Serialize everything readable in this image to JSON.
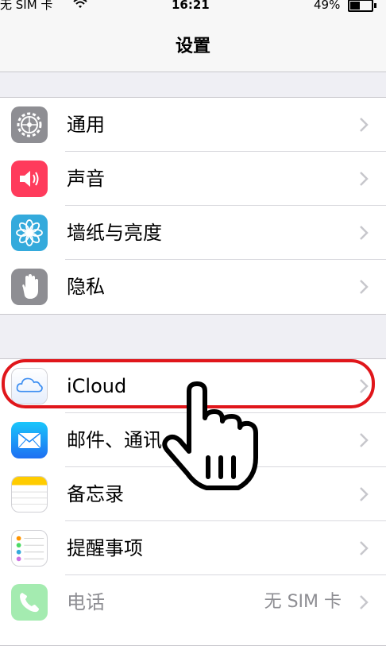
{
  "status_bar": {
    "carrier": "无 SIM 卡",
    "time": "16:21",
    "battery_percent": "49%",
    "battery_level": 0.49
  },
  "nav": {
    "title": "设置"
  },
  "group1": [
    {
      "label": "通用",
      "icon": "gear-icon",
      "color": "#8e8e93"
    },
    {
      "label": "声音",
      "icon": "speaker-icon",
      "color": "#ff3b5c"
    },
    {
      "label": "墙纸与亮度",
      "icon": "flower-icon",
      "color": "#34aadc"
    },
    {
      "label": "隐私",
      "icon": "hand-icon",
      "color": "#8e8e93"
    }
  ],
  "group2": [
    {
      "label": "iCloud",
      "icon": "cloud-icon",
      "color": "#ffffff"
    },
    {
      "label": "邮件、通讯",
      "icon": "mail-icon",
      "color": "#1e8bf7"
    },
    {
      "label": "备忘录",
      "icon": "notes-icon",
      "color": "#ffffff"
    },
    {
      "label": "提醒事项",
      "icon": "reminders-icon",
      "color": "#ffffff"
    },
    {
      "label": "电话",
      "detail": "无 SIM 卡",
      "icon": "phone-icon",
      "color": "#4cd964"
    }
  ],
  "annotation": {
    "highlight_color": "#e0161b",
    "pointer": "pointing-hand-icon"
  }
}
